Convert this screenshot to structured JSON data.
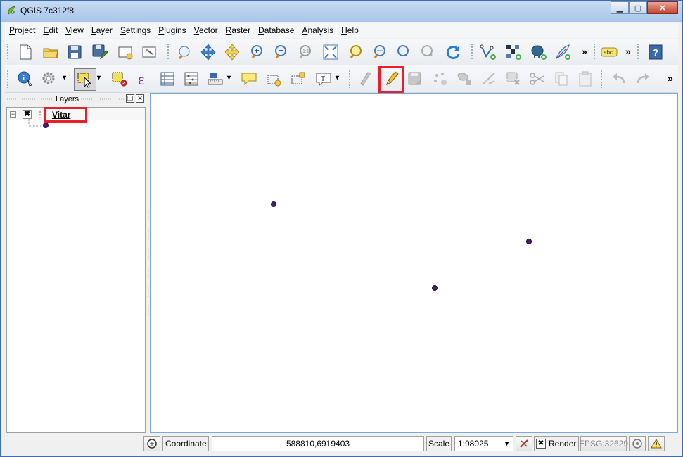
{
  "window": {
    "title": "QGIS 7c312f8"
  },
  "menu": [
    "Project",
    "Edit",
    "View",
    "Layer",
    "Settings",
    "Plugins",
    "Vector",
    "Raster",
    "Database",
    "Analysis",
    "Help"
  ],
  "menu_mnemonics": [
    "P",
    "E",
    "V",
    "L",
    "S",
    "P",
    "V",
    "R",
    "D",
    "A",
    "H"
  ],
  "toolbar_overflow": "»",
  "layers_panel": {
    "title": "Layers",
    "layers": [
      {
        "name": "Vitar",
        "visible": true,
        "symbol_color": "#4a1a78"
      }
    ]
  },
  "map": {
    "points": [
      {
        "x": 0.233,
        "y": 0.327
      },
      {
        "x": 0.539,
        "y": 0.574
      },
      {
        "x": 0.718,
        "y": 0.437
      }
    ]
  },
  "status": {
    "coordinate_label": "Coordinate:",
    "coordinate_value": "588810,6919403",
    "scale_label": "Scale",
    "scale_value": "1:98025",
    "render_label": "Render",
    "crs": "EPSG:32629"
  },
  "colors": {
    "highlight": "#e8202a",
    "point": "#4a1a78"
  }
}
